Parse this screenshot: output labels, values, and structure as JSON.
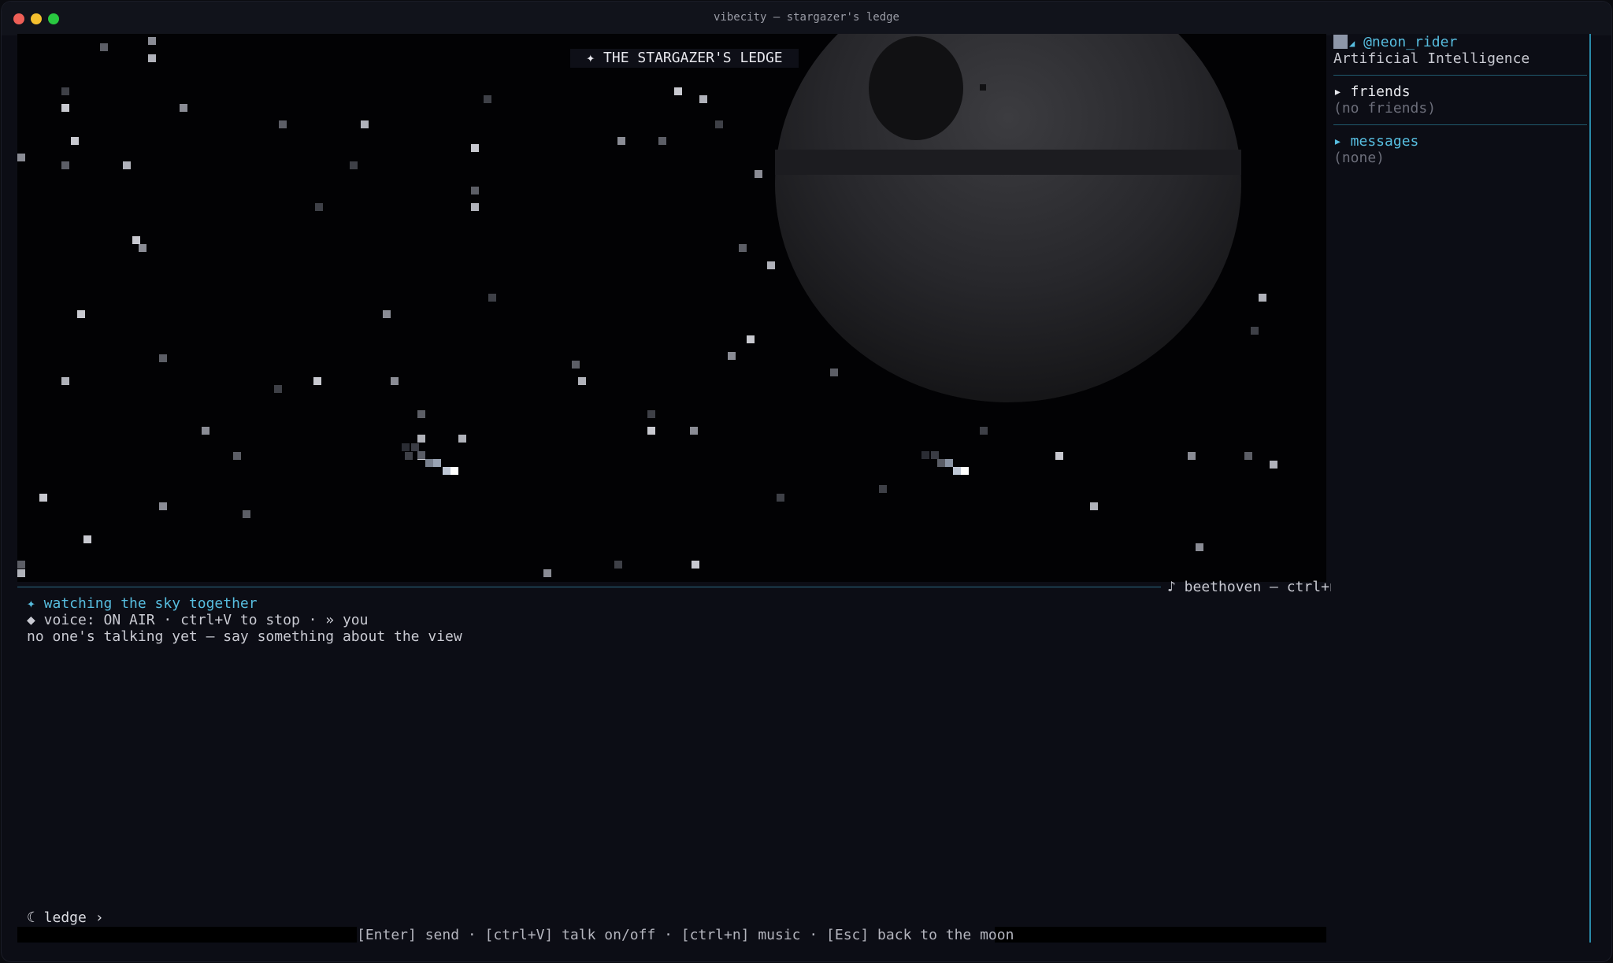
{
  "window": {
    "title": "vibecity — stargazer's ledge"
  },
  "scene": {
    "title": "✦ THE STARGAZER'S LEDGE",
    "moon_icon": "moon-icon"
  },
  "music": {
    "label": "♪ beethoven — ctrl+n"
  },
  "chat": {
    "status_line": "✦ watching the sky together",
    "voice_line": "◆ voice: ON AIR · ctrl+V to stop · » you",
    "empty_line": "no one's talking yet — say something about the view"
  },
  "prompt": {
    "text": "☾ ledge ›"
  },
  "help": {
    "text": "[Enter] send · [ctrl+V] talk on/off · [ctrl+n] music · [Esc] back to the moon"
  },
  "sidebar": {
    "username": "@neon_rider",
    "user_subtitle": "Artificial Intelligence",
    "friends_header": "▸ friends",
    "friends_empty": "(no friends)",
    "messages_header": "▸ messages",
    "messages_empty": "(none)"
  },
  "colors": {
    "accent": "#57bddf",
    "background": "#0c0d15",
    "close": "#ee5f57",
    "minimize": "#f4bf2e",
    "maximize": "#29c840"
  }
}
